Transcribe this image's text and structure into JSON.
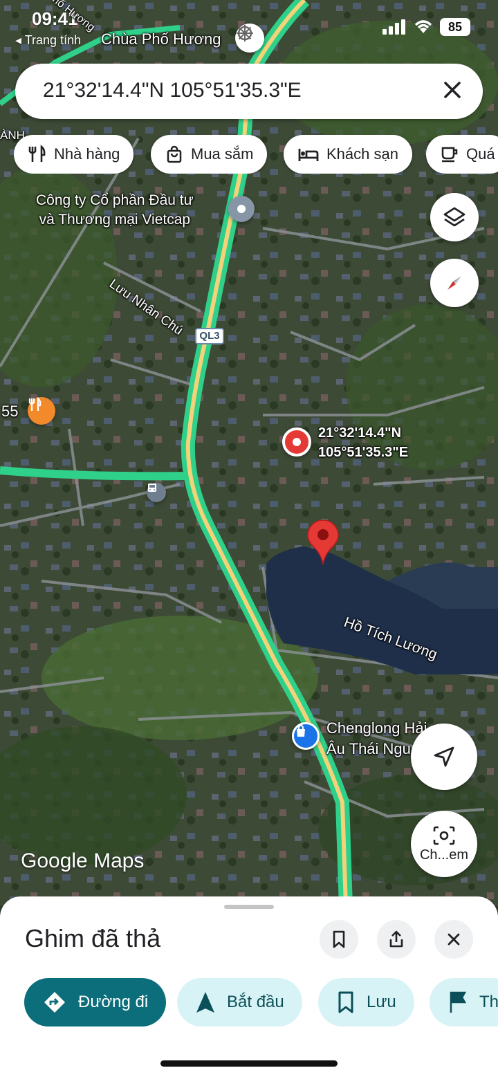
{
  "status_bar": {
    "time": "09:41",
    "back_app": "◂ Trang tính",
    "battery": "85"
  },
  "search": {
    "query": "21°32'14.4\"N 105°51'35.3\"E"
  },
  "chips": [
    {
      "label": "Nhà hàng",
      "icon": "fork-knife-icon"
    },
    {
      "label": "Mua sắm",
      "icon": "shopping-bag-icon"
    },
    {
      "label": "Khách sạn",
      "icon": "bed-icon"
    },
    {
      "label": "Quá",
      "icon": "coffee-cup-icon"
    }
  ],
  "map": {
    "labels": {
      "temple": "Chùa Phố Hương",
      "road_top": "Phố Hương",
      "company_line1": "Công ty Cổ phần Đầu tư",
      "company_line2": "và Thương mại Vietcap",
      "street": "Lưu Nhân Chú",
      "highway": "QL3",
      "restaurant_number": "55",
      "pin_coord_line1": "21°32'14.4\"N",
      "pin_coord_line2": "105°51'35.3\"E",
      "lake": "Hồ Tích Lương",
      "shop_line1": "Chenglong Hải",
      "shop_line2": "Âu Thái Ngu",
      "left_edge": "ÀNH"
    },
    "camera_button_label": "Ch...em",
    "attribution": "Google Maps",
    "colors": {
      "highway": "#2fd08a",
      "highway_center": "#f3d27a",
      "pin": "#e53935",
      "water": "#1f2f4a"
    }
  },
  "sheet": {
    "title": "Ghim đã thả",
    "actions": [
      {
        "label": "Đường đi",
        "icon": "directions-icon"
      },
      {
        "label": "Bắt đầu",
        "icon": "navigation-arrow-icon"
      },
      {
        "label": "Lưu",
        "icon": "bookmark-icon"
      },
      {
        "label": "Th",
        "icon": "flag-icon"
      }
    ]
  }
}
